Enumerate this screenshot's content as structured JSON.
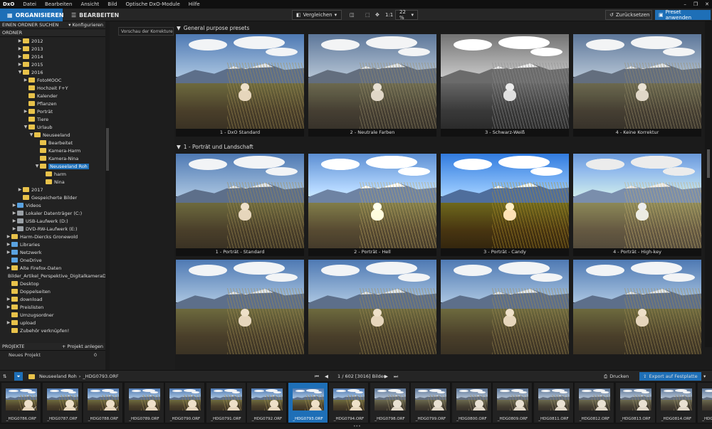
{
  "app": {
    "logo": "DxO",
    "menu": [
      "Datei",
      "Bearbeiten",
      "Ansicht",
      "Bild",
      "Optische DxO-Module",
      "Hilfe"
    ],
    "window_controls": [
      "–",
      "❐",
      "✕"
    ]
  },
  "toolbar": {
    "tab_organize": "ORGANISIEREN",
    "tab_edit": "BEARBEITEN",
    "compare_label": "Vergleichen",
    "zoom_fit": "1:1",
    "zoom_value": "22 %",
    "reset_label": "Zurücksetzen",
    "apply_label": "Preset anwenden"
  },
  "left_panel": {
    "search_label": "EINEN ORDNER SUCHEN",
    "configure_label": "Konfigurieren",
    "folder_header": "ORDNER",
    "tree": [
      {
        "label": "2012",
        "indent": 3,
        "arrow": "▶",
        "icon": "folder"
      },
      {
        "label": "2013",
        "indent": 3,
        "arrow": "▶",
        "icon": "folder"
      },
      {
        "label": "2014",
        "indent": 3,
        "arrow": "▶",
        "icon": "folder"
      },
      {
        "label": "2015",
        "indent": 3,
        "arrow": "▶",
        "icon": "folder"
      },
      {
        "label": "2016",
        "indent": 3,
        "arrow": "▼",
        "icon": "folder"
      },
      {
        "label": "FotoMOOC",
        "indent": 4,
        "arrow": "▶",
        "icon": "folder"
      },
      {
        "label": "Hochzeit F+Y",
        "indent": 4,
        "arrow": "",
        "icon": "folder"
      },
      {
        "label": "Kalender",
        "indent": 4,
        "arrow": "",
        "icon": "folder"
      },
      {
        "label": "Pflanzen",
        "indent": 4,
        "arrow": "",
        "icon": "folder"
      },
      {
        "label": "Porträt",
        "indent": 4,
        "arrow": "▶",
        "icon": "folder"
      },
      {
        "label": "Tiere",
        "indent": 4,
        "arrow": "",
        "icon": "folder"
      },
      {
        "label": "Urlaub",
        "indent": 4,
        "arrow": "▼",
        "icon": "folder"
      },
      {
        "label": "Neuseeland",
        "indent": 5,
        "arrow": "▼",
        "icon": "folder"
      },
      {
        "label": "Bearbeitet",
        "indent": 6,
        "arrow": "",
        "icon": "folder"
      },
      {
        "label": "Kamera-Harm",
        "indent": 6,
        "arrow": "",
        "icon": "folder"
      },
      {
        "label": "Kamera-Nina",
        "indent": 6,
        "arrow": "",
        "icon": "folder"
      },
      {
        "label": "Neuseeland Roh",
        "indent": 6,
        "arrow": "▼",
        "icon": "folder",
        "selected": true
      },
      {
        "label": "harm",
        "indent": 7,
        "arrow": "",
        "icon": "folder"
      },
      {
        "label": "Nina",
        "indent": 7,
        "arrow": "",
        "icon": "folder"
      },
      {
        "label": "2017",
        "indent": 3,
        "arrow": "▶",
        "icon": "folder"
      },
      {
        "label": "Gespeicherte Bilder",
        "indent": 3,
        "arrow": "",
        "icon": "folder"
      },
      {
        "label": "Videos",
        "indent": 2,
        "arrow": "▶",
        "icon": "folder blue"
      },
      {
        "label": "Lokaler Datenträger (C:)",
        "indent": 2,
        "arrow": "▶",
        "icon": "folder grey"
      },
      {
        "label": "USB-Laufwerk (D:)",
        "indent": 2,
        "arrow": "▶",
        "icon": "folder grey"
      },
      {
        "label": "DVD-RW-Laufwerk (E:)",
        "indent": 2,
        "arrow": "▶",
        "icon": "folder grey"
      },
      {
        "label": "Harm-Diercks Gronewold",
        "indent": 1,
        "arrow": "▶",
        "icon": "folder"
      },
      {
        "label": "Libraries",
        "indent": 1,
        "arrow": "▶",
        "icon": "folder blue"
      },
      {
        "label": "Netzwerk",
        "indent": 1,
        "arrow": "▶",
        "icon": "folder blue"
      },
      {
        "label": "OneDrive",
        "indent": 1,
        "arrow": "",
        "icon": "folder blue"
      },
      {
        "label": "Alte Firefox-Daten",
        "indent": 1,
        "arrow": "▶",
        "icon": "folder"
      },
      {
        "label": "Bilder_Artikel_Perspektive_DigitalkameraDE",
        "indent": 1,
        "arrow": "",
        "icon": "folder"
      },
      {
        "label": "Desktop",
        "indent": 1,
        "arrow": "",
        "icon": "folder"
      },
      {
        "label": "Doppelseiten",
        "indent": 1,
        "arrow": "",
        "icon": "folder"
      },
      {
        "label": "download",
        "indent": 1,
        "arrow": "▶",
        "icon": "folder"
      },
      {
        "label": "Preislisten",
        "indent": 1,
        "arrow": "▶",
        "icon": "folder"
      },
      {
        "label": "Umzugsordner",
        "indent": 1,
        "arrow": "",
        "icon": "folder"
      },
      {
        "label": "upload",
        "indent": 1,
        "arrow": "▶",
        "icon": "folder"
      },
      {
        "label": "Zubehör verknüpfen!",
        "indent": 1,
        "arrow": "",
        "icon": "folder"
      }
    ],
    "projects_header": "PROJEKTE",
    "add_project_label": "Projekt anlegen",
    "project_name": "Neues Projekt",
    "project_count": "0"
  },
  "middle_panel": {
    "preview_label": "Vorschau der Korrekturen"
  },
  "presets": {
    "section1_title": "General purpose presets",
    "section2_title": "1 - Porträt und Landschaft",
    "row1": [
      "1 - DxO Standard",
      "2 - Neutrale Farben",
      "3 - Schwarz-Weiß",
      "4 - Keine Korrektur"
    ],
    "row2": [
      "1 - Porträt - Standard",
      "2 - Porträt - Hell",
      "3 - Porträt - Candy",
      "4 - Porträt - High-key"
    ]
  },
  "filmstrip_bar": {
    "breadcrumb": "Neuseeland Roh",
    "breadcrumb_sep": "›",
    "current_file": "_HDG0793.ORF",
    "counter": "1 / 602 [3016] Bilder",
    "print_label": "Drucken",
    "export_label": "Export auf Festplatte"
  },
  "filmstrip": [
    "_HDG0786.ORF",
    "_HDG0787.ORF",
    "_HDG0788.ORF",
    "_HDG0789.ORF",
    "_HDG0790.ORF",
    "_HDG0791.ORF",
    "_HDG0792.ORF",
    "_HDG0793.ORF",
    "_HDG0794.ORF",
    "_HDG0798.ORF",
    "_HDG0799.ORF",
    "_HDG0800.ORF",
    "_HDG0809.ORF",
    "_HDG0811.ORF",
    "_HDG0812.ORF",
    "_HDG0813.ORF",
    "_HDG0814.ORF",
    "_HDG0815.ORF"
  ],
  "colors": {
    "accent": "#1e6fb7",
    "panel": "#222222",
    "background": "#1b1b1b"
  }
}
